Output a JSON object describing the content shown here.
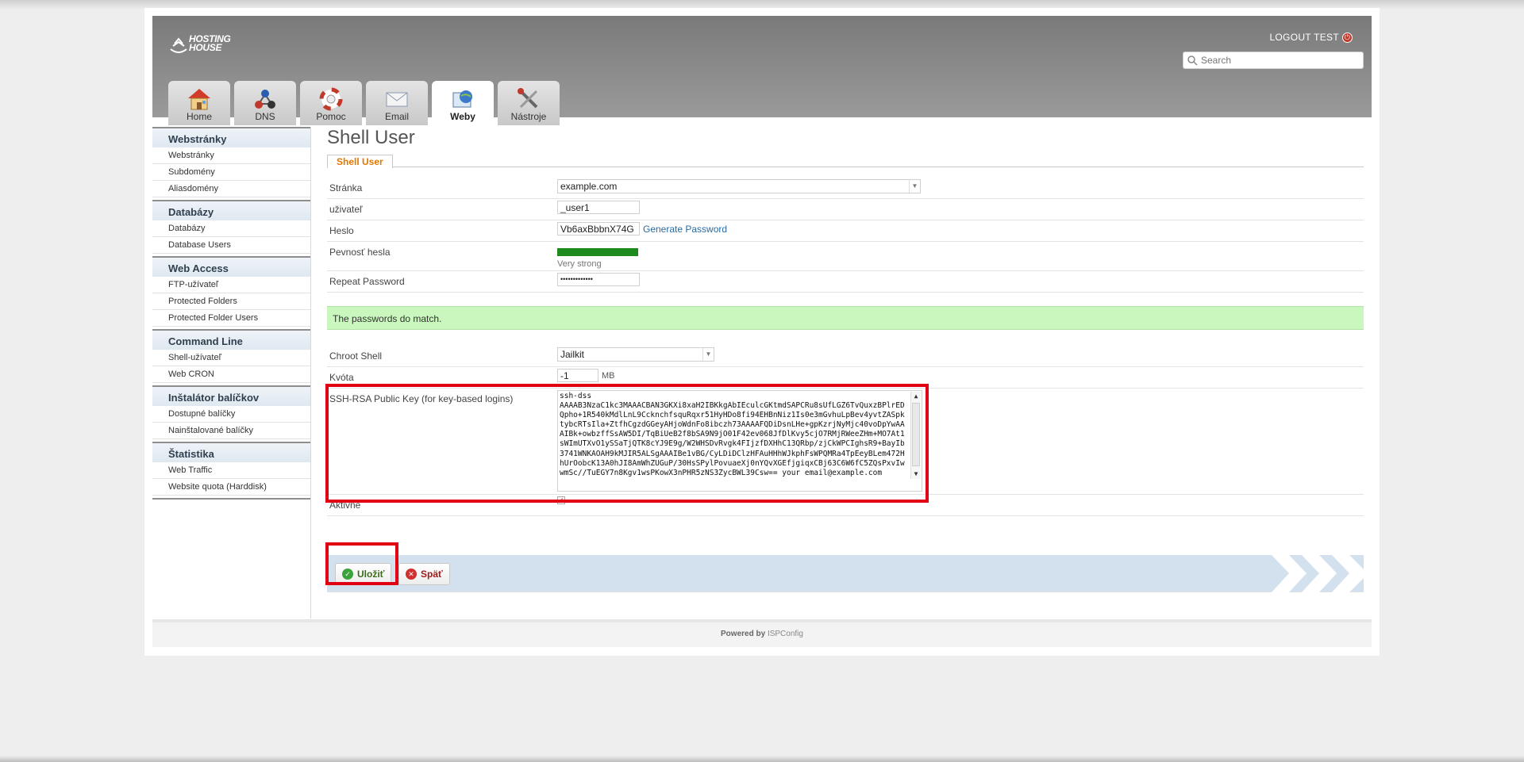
{
  "header": {
    "logo_line1": "HOSTING",
    "logo_line2": "HOUSE",
    "logout_label": "LOGOUT TEST",
    "search_placeholder": "Search"
  },
  "tabs": [
    {
      "label": "Home",
      "icon": "house-icon"
    },
    {
      "label": "DNS",
      "icon": "network-icon"
    },
    {
      "label": "Pomoc",
      "icon": "lifebuoy-icon"
    },
    {
      "label": "Email",
      "icon": "envelope-icon"
    },
    {
      "label": "Weby",
      "icon": "globe-icon",
      "active": true
    },
    {
      "label": "Nástroje",
      "icon": "tools-icon"
    }
  ],
  "sidebar": {
    "sections": [
      {
        "title": "Webstránky",
        "items": [
          "Webstránky",
          "Subdomény",
          "Aliasdomény"
        ]
      },
      {
        "title": "Databázy",
        "items": [
          "Databázy",
          "Database Users"
        ]
      },
      {
        "title": "Web Access",
        "items": [
          "FTP-užívateľ",
          "Protected Folders",
          "Protected Folder Users"
        ]
      },
      {
        "title": "Command Line",
        "items": [
          "Shell-užívateľ",
          "Web CRON"
        ]
      },
      {
        "title": "Inštalátor balíčkov",
        "items": [
          "Dostupné balíčky",
          "Nainštalované balíčky"
        ]
      },
      {
        "title": "Štatistika",
        "items": [
          "Web Traffic",
          "Website quota (Harddisk)"
        ]
      }
    ]
  },
  "main": {
    "title": "Shell User",
    "subtab": "Shell User",
    "fields": {
      "site_label": "Stránka",
      "site_value": "example.com",
      "user_label": "uživateľ",
      "user_value": "_user1",
      "password_label": "Heslo",
      "password_value": "Vb6axBbbnX74G",
      "generate_password": "Generate Password",
      "strength_label": "Pevnosť hesla",
      "strength_text": "Very strong",
      "strength_level": 1.0,
      "repeat_label": "Repeat Password",
      "repeat_value": "•••••••••••••",
      "match_message": "The passwords do match.",
      "chroot_label": "Chroot Shell",
      "chroot_value": "Jailkit",
      "quota_label": "Kvóta",
      "quota_value": "-1",
      "quota_unit": "MB",
      "sshkey_label": "SSH-RSA Public Key (for key-based logins)",
      "sshkey_value": "ssh-dss\nAAAAB3NzaC1kc3MAAACBAN3GKXi8xaH2IBKkgAbIEculcGKtmdSAPCRu8sUfLGZ6TvQuxzBPlrEDQpho+1R540kMdlLnL9CcknchfsquRqxr51HyHDo8fi94EHBnNiz1Is0e3mGvhuLpBev4yvtZASpktybcRTsIla+ZtfhCgzdGGeyAHjoWdnFo8ibczh73AAAAFQDiDsnLHe+gpKzrjNyMjc40voDpYwAAAIBk+owbzffSsAW5DI/TqBiUeB2f8bSA9N9jO01F42ev068JfDlKvy5cjO7RMjRWeeZHm+MO7At1sWImUTXvO1ySSaTjQTK8cYJ9E9g/W2WHSDvRvgk4FIjzfDXHhC13QRbp/zjCkWPCIghsR9+BayIb3741WNKAOAH9kMJIR5ALSgAAAIBe1vBG/CyLDiDClzHFAuHHhWJkphFsWPQMRa4TpEeyBLem472HhUrOobcK13A0hJI8AmWhZUGuP/30HsSPylPovuaeXj0nYQvXGEfjgiqxCBj63C6W6fC5ZQsPxvIwwmSc//TuEGY7n8Kgv1wsPKowX3nPHR5zNS3ZycBWL39Csw== your email@example.com",
      "active_label": "Aktivné",
      "active_checked": true
    },
    "buttons": {
      "save": "Uložiť",
      "back": "Späť"
    }
  },
  "footer": {
    "powered": "Powered by",
    "brand": "ISPConfig"
  },
  "colors": {
    "accent_orange": "#e07800",
    "highlight_red": "#e00012",
    "match_green": "#c9f7bd",
    "strength_green": "#1c8a1c"
  }
}
